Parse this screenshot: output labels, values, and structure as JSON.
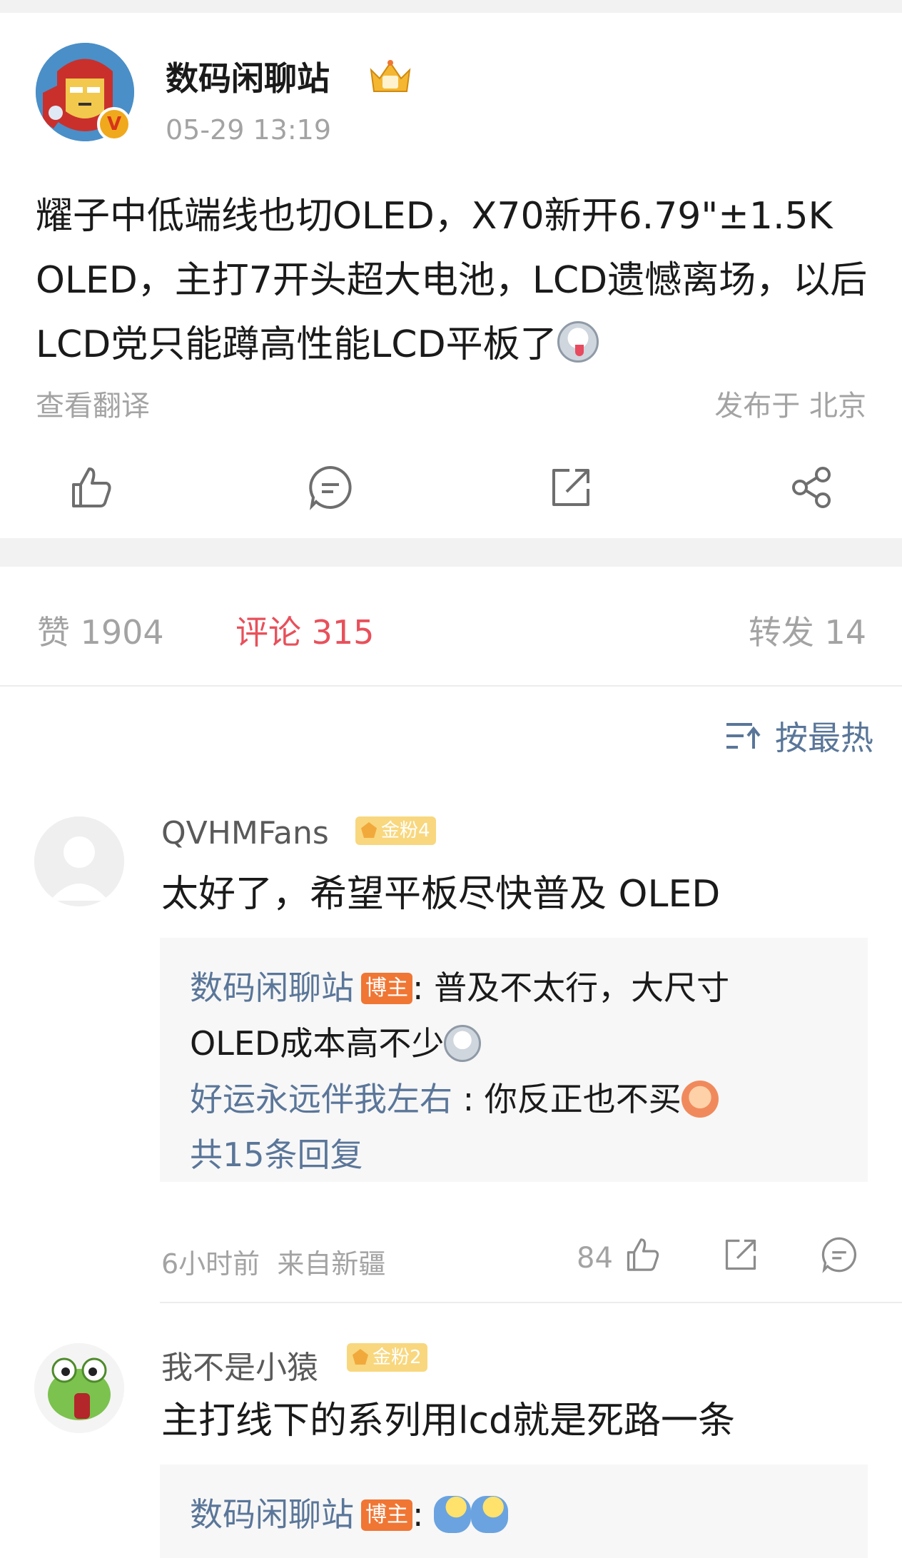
{
  "post": {
    "author": "数码闲聊站",
    "time": "05-29 13:19",
    "content": "耀子中低端线也切OLED，X70新开6.79\"±1.5K OLED，主打7开头超大电池，LCD遗憾离场，以后LCD党只能蹲高性能LCD平板了",
    "translate": "查看翻译",
    "location": "发布于 北京",
    "icons": [
      "like-icon",
      "comment-icon",
      "repost-icon",
      "share-icon"
    ]
  },
  "stats": {
    "likes": "赞 1904",
    "comments": "评论 315",
    "reposts": "转发 14"
  },
  "sort": {
    "label": "按最热"
  },
  "comments": [
    {
      "user": "QVHMFans",
      "badge": "金粉4",
      "text": "太好了，希望平板尽快普及 OLED",
      "replies": [
        {
          "name": "数码闲聊站",
          "tag": "博主",
          "text": ": 普及不太行，大尺寸",
          "text2": "OLED成本高不少"
        },
        {
          "name": "好运永远伴我左右",
          "text": " : 你反正也不买"
        }
      ],
      "more": "共15条回复",
      "time": "6小时前",
      "source": "来自新疆",
      "like_count": "84"
    },
    {
      "user": "我不是小猿",
      "badge": "金粉2",
      "text": "主打线下的系列用lcd就是死路一条",
      "replies": [
        {
          "name": "数码闲聊站",
          "tag": "博主",
          "text": ":"
        }
      ]
    }
  ],
  "colors": {
    "accent": "#e8505b",
    "link": "#5a7699",
    "muted": "#a3a3a3",
    "host_tag": "#f07634"
  }
}
